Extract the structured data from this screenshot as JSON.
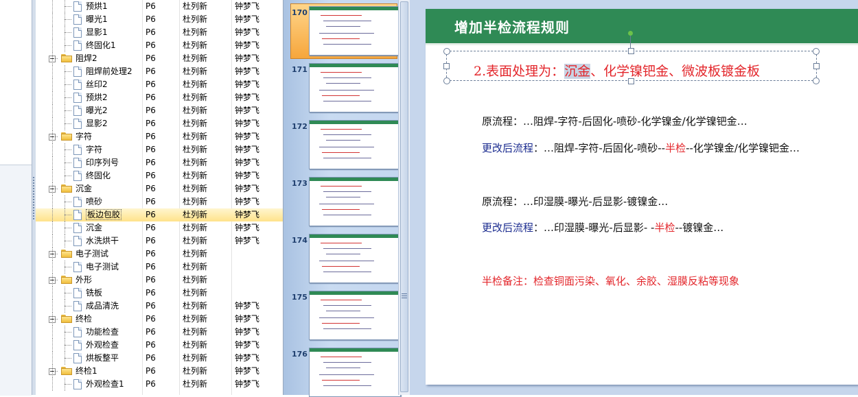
{
  "tree": {
    "rows": [
      {
        "name": "预烘1",
        "code": "P6",
        "person1": "杜列新",
        "person2": "钟梦飞",
        "level": 2,
        "type": "doc"
      },
      {
        "name": "曝光1",
        "code": "P6",
        "person1": "杜列新",
        "person2": "钟梦飞",
        "level": 2,
        "type": "doc"
      },
      {
        "name": "显影1",
        "code": "P6",
        "person1": "杜列新",
        "person2": "钟梦飞",
        "level": 2,
        "type": "doc"
      },
      {
        "name": "终固化1",
        "code": "P6",
        "person1": "杜列新",
        "person2": "钟梦飞",
        "level": 2,
        "type": "doc"
      },
      {
        "name": "阻焊2",
        "code": "P6",
        "person1": "杜列新",
        "person2": "钟梦飞",
        "level": 1,
        "type": "folder"
      },
      {
        "name": "阻焊前处理2",
        "code": "P6",
        "person1": "杜列新",
        "person2": "钟梦飞",
        "level": 2,
        "type": "doc"
      },
      {
        "name": "丝印2",
        "code": "P6",
        "person1": "杜列新",
        "person2": "钟梦飞",
        "level": 2,
        "type": "doc"
      },
      {
        "name": "预烘2",
        "code": "P6",
        "person1": "杜列新",
        "person2": "钟梦飞",
        "level": 2,
        "type": "doc"
      },
      {
        "name": "曝光2",
        "code": "P6",
        "person1": "杜列新",
        "person2": "钟梦飞",
        "level": 2,
        "type": "doc"
      },
      {
        "name": "显影2",
        "code": "P6",
        "person1": "杜列新",
        "person2": "钟梦飞",
        "level": 2,
        "type": "doc"
      },
      {
        "name": "字符",
        "code": "P6",
        "person1": "杜列新",
        "person2": "钟梦飞",
        "level": 1,
        "type": "folder"
      },
      {
        "name": "字符",
        "code": "P6",
        "person1": "杜列新",
        "person2": "钟梦飞",
        "level": 2,
        "type": "doc"
      },
      {
        "name": "印序列号",
        "code": "P6",
        "person1": "杜列新",
        "person2": "钟梦飞",
        "level": 2,
        "type": "doc"
      },
      {
        "name": "终固化",
        "code": "P6",
        "person1": "杜列新",
        "person2": "钟梦飞",
        "level": 2,
        "type": "doc"
      },
      {
        "name": "沉金",
        "code": "P6",
        "person1": "杜列新",
        "person2": "钟梦飞",
        "level": 1,
        "type": "folder"
      },
      {
        "name": "喷砂",
        "code": "P6",
        "person1": "杜列新",
        "person2": "钟梦飞",
        "level": 2,
        "type": "doc"
      },
      {
        "name": "板边包胶",
        "code": "P6",
        "person1": "杜列新",
        "person2": "钟梦飞",
        "level": 2,
        "type": "doc",
        "selected": true
      },
      {
        "name": "沉金",
        "code": "P6",
        "person1": "杜列新",
        "person2": "钟梦飞",
        "level": 2,
        "type": "doc"
      },
      {
        "name": "水洗烘干",
        "code": "P6",
        "person1": "杜列新",
        "person2": "钟梦飞",
        "level": 2,
        "type": "doc"
      },
      {
        "name": "电子测试",
        "code": "P6",
        "person1": "杜列新",
        "person2": "",
        "level": 1,
        "type": "folder"
      },
      {
        "name": "电子测试",
        "code": "P6",
        "person1": "杜列新",
        "person2": "",
        "level": 2,
        "type": "doc"
      },
      {
        "name": "外形",
        "code": "P6",
        "person1": "杜列新",
        "person2": "",
        "level": 1,
        "type": "folder"
      },
      {
        "name": "铣板",
        "code": "P6",
        "person1": "杜列新",
        "person2": "",
        "level": 2,
        "type": "doc"
      },
      {
        "name": "成品清洗",
        "code": "P6",
        "person1": "杜列新",
        "person2": "钟梦飞",
        "level": 2,
        "type": "doc"
      },
      {
        "name": "终检",
        "code": "P6",
        "person1": "杜列新",
        "person2": "钟梦飞",
        "level": 1,
        "type": "folder"
      },
      {
        "name": "功能检查",
        "code": "P6",
        "person1": "杜列新",
        "person2": "钟梦飞",
        "level": 2,
        "type": "doc"
      },
      {
        "name": "外观检查",
        "code": "P6",
        "person1": "杜列新",
        "person2": "钟梦飞",
        "level": 2,
        "type": "doc"
      },
      {
        "name": "烘板整平",
        "code": "P6",
        "person1": "杜列新",
        "person2": "钟梦飞",
        "level": 2,
        "type": "doc"
      },
      {
        "name": "终检1",
        "code": "P6",
        "person1": "杜列新",
        "person2": "钟梦飞",
        "level": 1,
        "type": "folder"
      },
      {
        "name": "外观检查1",
        "code": "P6",
        "person1": "杜列新",
        "person2": "钟梦飞",
        "level": 2,
        "type": "doc"
      }
    ]
  },
  "thumbnails": [
    {
      "number": "170",
      "selected": true
    },
    {
      "number": "171"
    },
    {
      "number": "172"
    },
    {
      "number": "173"
    },
    {
      "number": "174"
    },
    {
      "number": "175"
    },
    {
      "number": "176"
    }
  ],
  "slide": {
    "title": "增加半检流程规则",
    "heading_prefix": "2.表面处理为：",
    "heading_highlight": "沉金",
    "heading_rest": "、化学镍钯金、微波板镀金板",
    "para1": "原流程：…阻焊-字符-后固化-喷砂-化学镍金/化学镍钯金…",
    "para2_label": "更改后流程",
    "para2_a": "：…阻焊-字符-后固化-喷砂--",
    "para2_red": "半检",
    "para2_b": "--化学镍金/化学镍钯金…",
    "para3": "原流程：…印湿膜-曝光-后显影-镀镍金…",
    "para4_label": "更改后流程",
    "para4_a": "：…印湿膜-曝光-后显影- -",
    "para4_red": "半检",
    "para4_b": "--镀镍金…",
    "note": "半检备注：检查铜面污染、氧化、余胶、湿膜反粘等现象"
  },
  "colors": {
    "header_green": "#2f8a55",
    "accent_red": "#e3262b",
    "label_blue": "#1a2b8f",
    "selected_row": "#ffe38a"
  }
}
